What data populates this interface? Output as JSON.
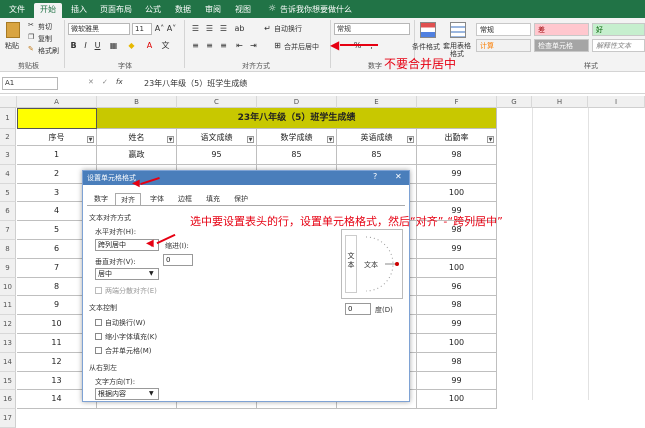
{
  "tabs": [
    "文件",
    "开始",
    "插入",
    "页面布局",
    "公式",
    "数据",
    "审阅",
    "视图"
  ],
  "tell_me": "告诉我你想要做什么",
  "clipboard": {
    "paste": "粘贴",
    "cut": "剪切",
    "copy": "复制",
    "format_painter": "格式刷",
    "group": "剪贴板"
  },
  "font": {
    "name": "微软雅黑",
    "size": "11",
    "bold": "B",
    "italic": "I",
    "underline": "U",
    "grow": "A˄",
    "shrink": "A˅",
    "group": "字体"
  },
  "alignment": {
    "wrap": "自动换行",
    "merge": "合并后居中",
    "group": "对齐方式"
  },
  "number": {
    "format": "常规",
    "percent": "%",
    "comma": ",",
    "group": "数字"
  },
  "styles": {
    "conditional": "条件格式",
    "table_format": "套用表格格式",
    "normal": "常规",
    "bad": "差",
    "good": "好",
    "calc": "计算",
    "check": "检查单元格",
    "explain": "解释性文本",
    "group": "样式"
  },
  "annotation_merge": "不要合并居中",
  "formula_bar": {
    "name_box": "A1",
    "cancel": "✕",
    "enter": "✓",
    "fx": "fx",
    "content": "23年八年级（5）班学生成绩"
  },
  "columns": [
    "A",
    "B",
    "C",
    "D",
    "E",
    "F",
    "G",
    "H",
    "I"
  ],
  "sheet": {
    "title": "23年八年级（5）班学生成绩",
    "headers": [
      "序号",
      "姓名",
      "语文成绩",
      "数学成绩",
      "英语成绩",
      "出勤率"
    ],
    "rows": [
      [
        "1",
        "嬴政",
        "95",
        "85",
        "85",
        "98"
      ],
      [
        "2",
        "",
        "",
        "",
        "",
        "99"
      ],
      [
        "3",
        "",
        "",
        "",
        "",
        "100"
      ],
      [
        "4",
        "",
        "",
        "",
        "",
        "99"
      ],
      [
        "5",
        "",
        "",
        "",
        "",
        "98"
      ],
      [
        "6",
        "",
        "",
        "",
        "",
        "99"
      ],
      [
        "7",
        "",
        "",
        "",
        "",
        "100"
      ],
      [
        "8",
        "",
        "",
        "",
        "",
        "96"
      ],
      [
        "9",
        "",
        "",
        "",
        "",
        "98"
      ],
      [
        "10",
        "",
        "",
        "",
        "",
        "99"
      ],
      [
        "11",
        "",
        "",
        "",
        "",
        "100"
      ],
      [
        "12",
        "",
        "",
        "",
        "",
        "98"
      ],
      [
        "13",
        "",
        "",
        "",
        "",
        "99"
      ],
      [
        "14",
        "",
        "",
        "",
        "",
        "100"
      ]
    ],
    "row_numbers": [
      "1",
      "2",
      "3",
      "4",
      "5",
      "6",
      "7",
      "8",
      "9",
      "10",
      "11",
      "12",
      "13",
      "14",
      "15",
      "16",
      "17"
    ]
  },
  "dialog": {
    "title": "设置单元格格式",
    "help": "?",
    "close": "✕",
    "tabs": [
      "数字",
      "对齐",
      "字体",
      "边框",
      "填充",
      "保护"
    ],
    "text_alignment": "文本对齐方式",
    "horizontal_label": "水平对齐(H):",
    "horizontal_value": "跨列居中",
    "indent_label": "缩进(I):",
    "indent_value": "0",
    "vertical_label": "垂直对齐(V):",
    "vertical_value": "居中",
    "distributed": "两端分散对齐(E)",
    "text_control": "文本控制",
    "wrap": "自动换行(W)",
    "shrink": "缩小字体填充(K)",
    "merge": "合并单元格(M)",
    "rtl": "从右到左",
    "direction_label": "文字方向(T):",
    "direction_value": "根据内容",
    "orientation_vertical": "文本",
    "orientation_horizontal": "文本",
    "degree_value": "0",
    "degree_label": "度(D)"
  },
  "annotation_dialog": "选中要设置表头的行，设置单元格格式，然后“对齐”-“跨列居中”",
  "colors": {
    "excel_green": "#217346",
    "title_yellow": "#c8c800",
    "a1_yellow": "#ffff00",
    "annotation_red": "#e60012",
    "dialog_blue": "#4a7ebb"
  }
}
